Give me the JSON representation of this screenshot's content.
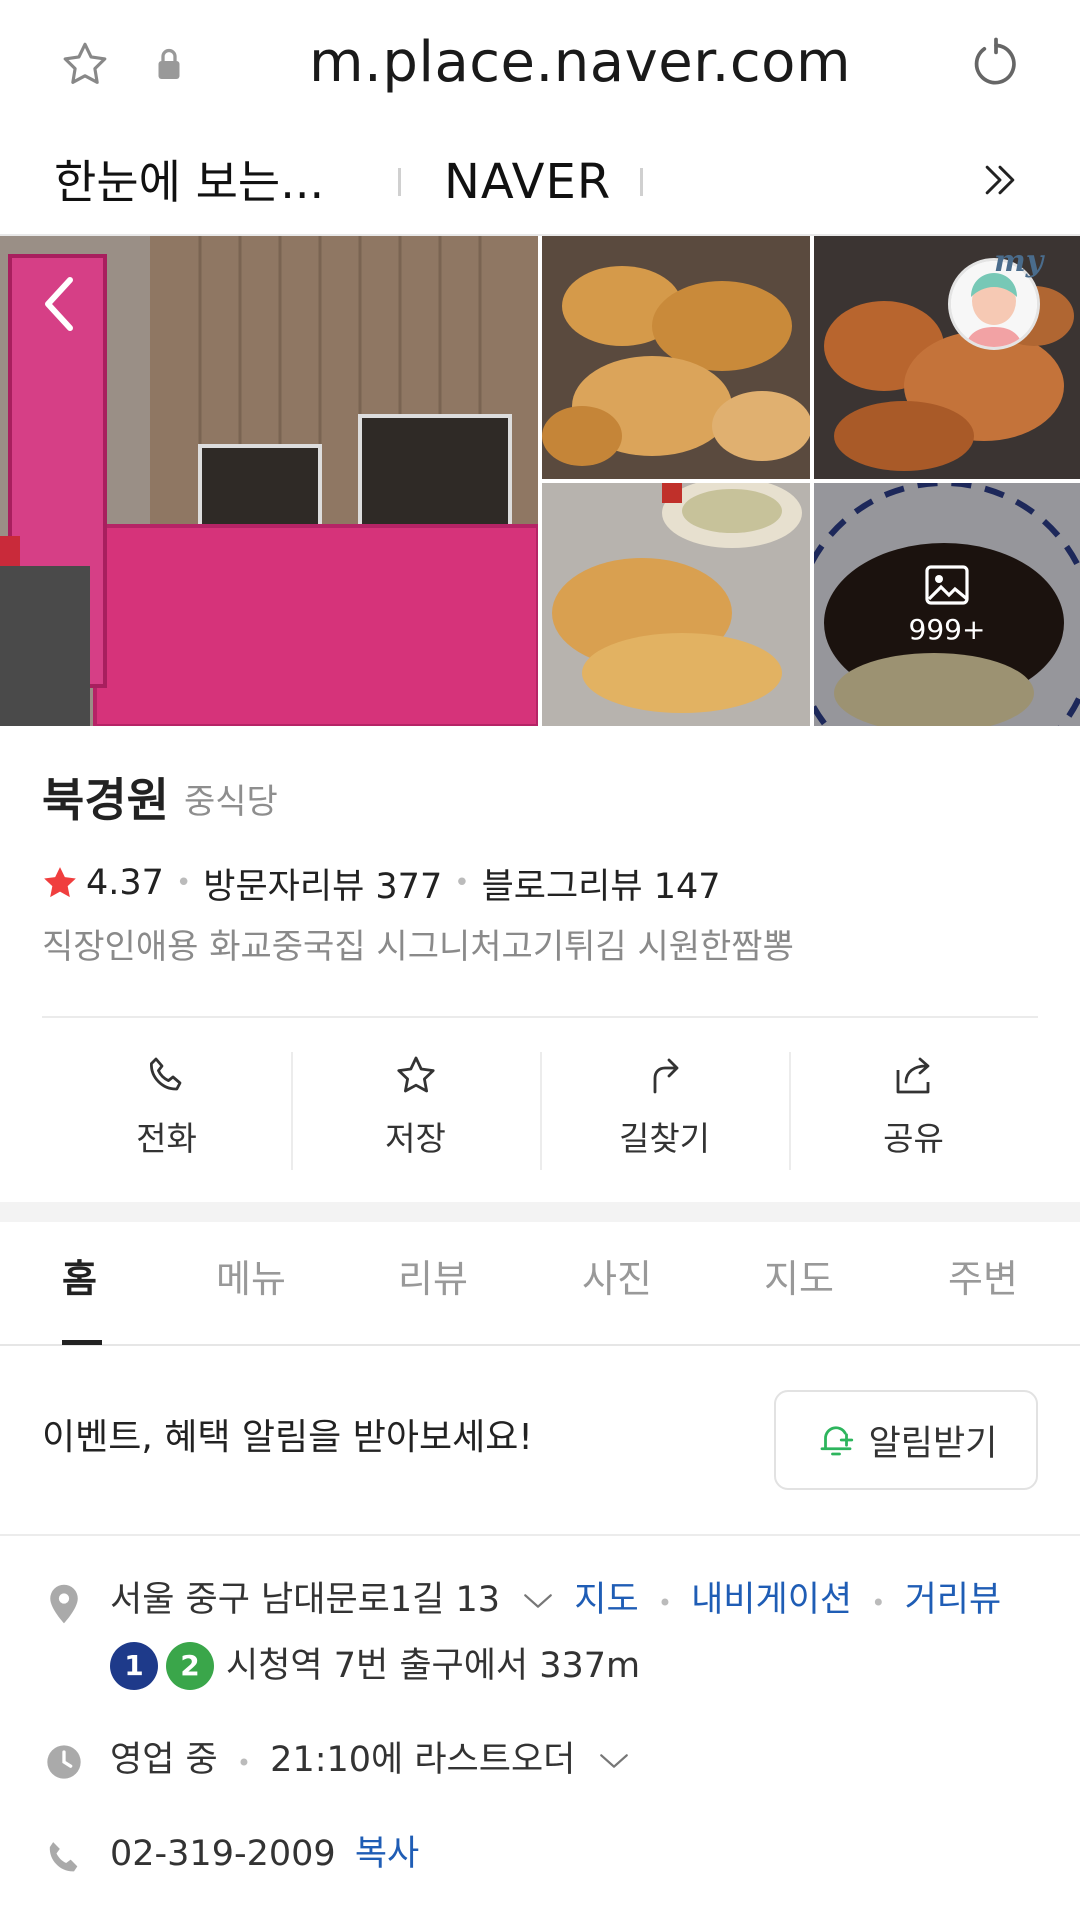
{
  "browser": {
    "url": "m.place.naver.com",
    "tabs": [
      "한눈에 보는...",
      "NAVER"
    ]
  },
  "photos": {
    "count_label": "999+",
    "avatar_tag": "my"
  },
  "place": {
    "name": "북경원",
    "category": "중식당",
    "rating": "4.37",
    "visitor_reviews": "방문자리뷰 377",
    "blog_reviews": "블로그리뷰 147",
    "keywords": "직장인애용 화교중국집 시그니처고기튀김 시원한짬뽕"
  },
  "actions": [
    {
      "label": "전화",
      "icon": "phone-icon"
    },
    {
      "label": "저장",
      "icon": "star-icon"
    },
    {
      "label": "길찾기",
      "icon": "directions-icon"
    },
    {
      "label": "공유",
      "icon": "share-icon"
    }
  ],
  "tabs": [
    "홈",
    "메뉴",
    "리뷰",
    "사진",
    "지도",
    "주변"
  ],
  "active_tab": "홈",
  "notice": {
    "text": "이벤트, 혜택 알림을 받아보세요!",
    "button": "알림받기"
  },
  "info": {
    "address": "서울 중구 남대문로1길 13",
    "map_link": "지도",
    "nav_link": "내비게이션",
    "street_link": "거리뷰",
    "subway_lines": [
      "1",
      "2"
    ],
    "subway_text": "시청역 7번 출구에서 337m",
    "status": "영업 중",
    "hours": "21:10에 라스트오더",
    "phone": "02-319-2009",
    "copy": "복사"
  },
  "colors": {
    "link": "#1f5db5",
    "line1": "#1e3a8a",
    "line2": "#3aa64a",
    "star": "#f03e3e",
    "bell": "#2db55d"
  }
}
